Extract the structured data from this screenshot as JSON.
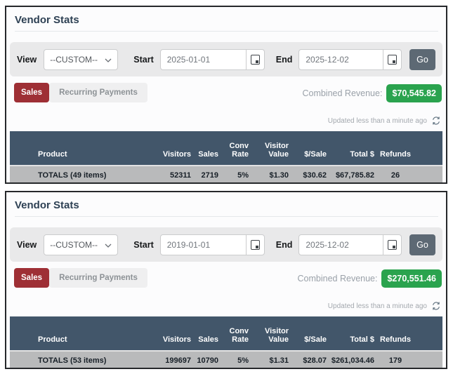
{
  "panels": [
    {
      "title": "Vendor Stats",
      "filter": {
        "view_label": "View",
        "view_value": "--CUSTOM--",
        "start_label": "Start",
        "start_value": "2025-01-01",
        "end_label": "End",
        "end_value": "2025-12-02",
        "go_label": "Go"
      },
      "tabs": {
        "sales": "Sales",
        "recurring": "Recurring Payments"
      },
      "revenue_label": "Combined Revenue:",
      "revenue_value": "$70,545.82",
      "updated": "Updated less than a minute ago",
      "table": {
        "headers": [
          "Product",
          "Visitors",
          "Sales",
          "Conv\nRate",
          "Visitor\nValue",
          "$/Sale",
          "Total $",
          "Refunds"
        ],
        "totals": [
          "TOTALS (49 items)",
          "52311",
          "2719",
          "5%",
          "$1.30",
          "$30.62",
          "$67,785.82",
          "26"
        ]
      }
    },
    {
      "title": "Vendor Stats",
      "filter": {
        "view_label": "View",
        "view_value": "--CUSTOM--",
        "start_label": "Start",
        "start_value": "2019-01-01",
        "end_label": "End",
        "end_value": "2025-12-02",
        "go_label": "Go"
      },
      "tabs": {
        "sales": "Sales",
        "recurring": "Recurring Payments"
      },
      "revenue_label": "Combined Revenue:",
      "revenue_value": "$270,551.46",
      "updated": "Updated less than a minute ago",
      "table": {
        "headers": [
          "Product",
          "Visitors",
          "Sales",
          "Conv\nRate",
          "Visitor\nValue",
          "$/Sale",
          "Total $",
          "Refunds"
        ],
        "totals": [
          "TOTALS (53 items)",
          "199697",
          "10790",
          "5%",
          "$1.31",
          "$28.07",
          "$261,034.46",
          "179"
        ]
      }
    }
  ],
  "icons": {
    "chevron": "chevron-down-icon",
    "calendar": "calendar-icon",
    "refresh": "refresh-icon"
  },
  "colors": {
    "sales_tab_red": "#9e2f35",
    "revenue_green": "#2aa34e",
    "table_header_blue": "#42566a",
    "totals_row_gray": "#b9babb",
    "go_button_gray": "#5d6974"
  }
}
